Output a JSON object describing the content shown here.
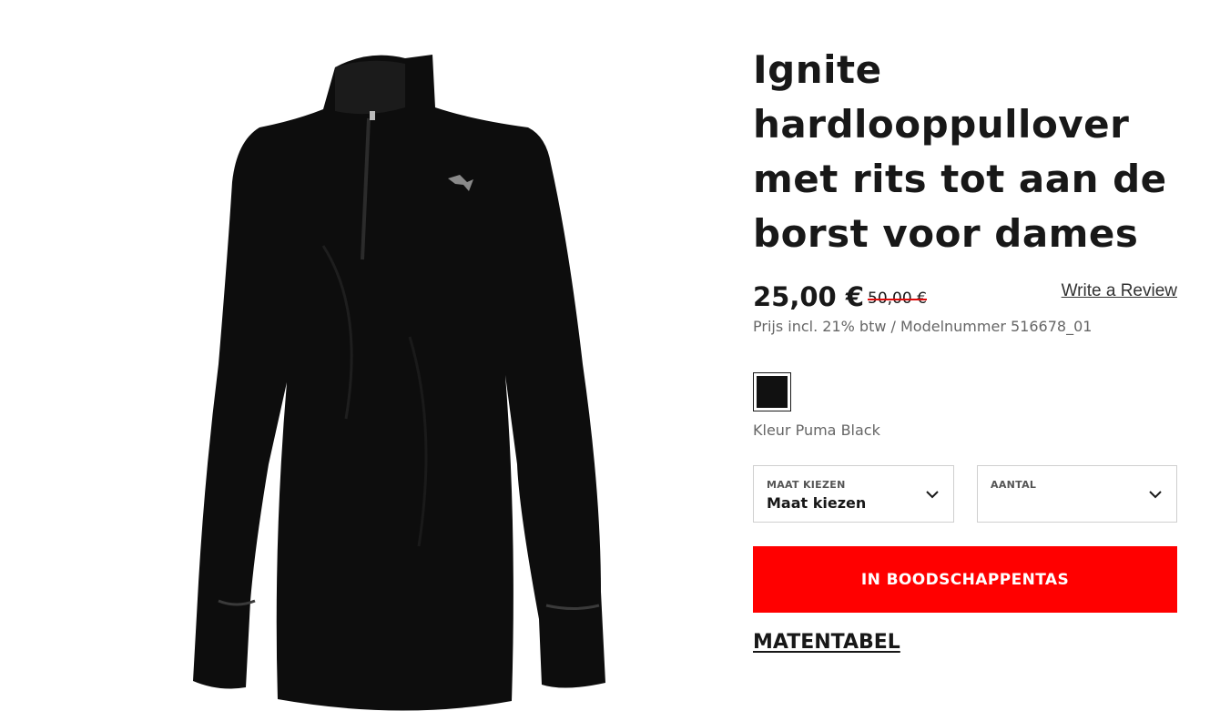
{
  "product": {
    "title": "Ignite hardlooppullover met rits tot aan de borst voor dames",
    "image_alt": "black-quarter-zip-running-pullover",
    "price_sale": "25,00 €",
    "price_original": "50,00 €",
    "price_note": "Prijs incl. 21% btw / Modelnummer 516678_01",
    "review_link": "Write a Review",
    "color": {
      "swatch_hex": "#111111",
      "label": "Kleur Puma Black"
    }
  },
  "selectors": {
    "size": {
      "label": "MAAT KIEZEN",
      "value": "Maat kiezen"
    },
    "quantity": {
      "label": "AANTAL",
      "value": ""
    }
  },
  "actions": {
    "add_to_cart": "IN BOODSCHAPPENTAS",
    "size_chart": "MATENTABEL"
  },
  "colors": {
    "accent": "#ff0000",
    "text": "#181818",
    "muted": "#666666"
  }
}
